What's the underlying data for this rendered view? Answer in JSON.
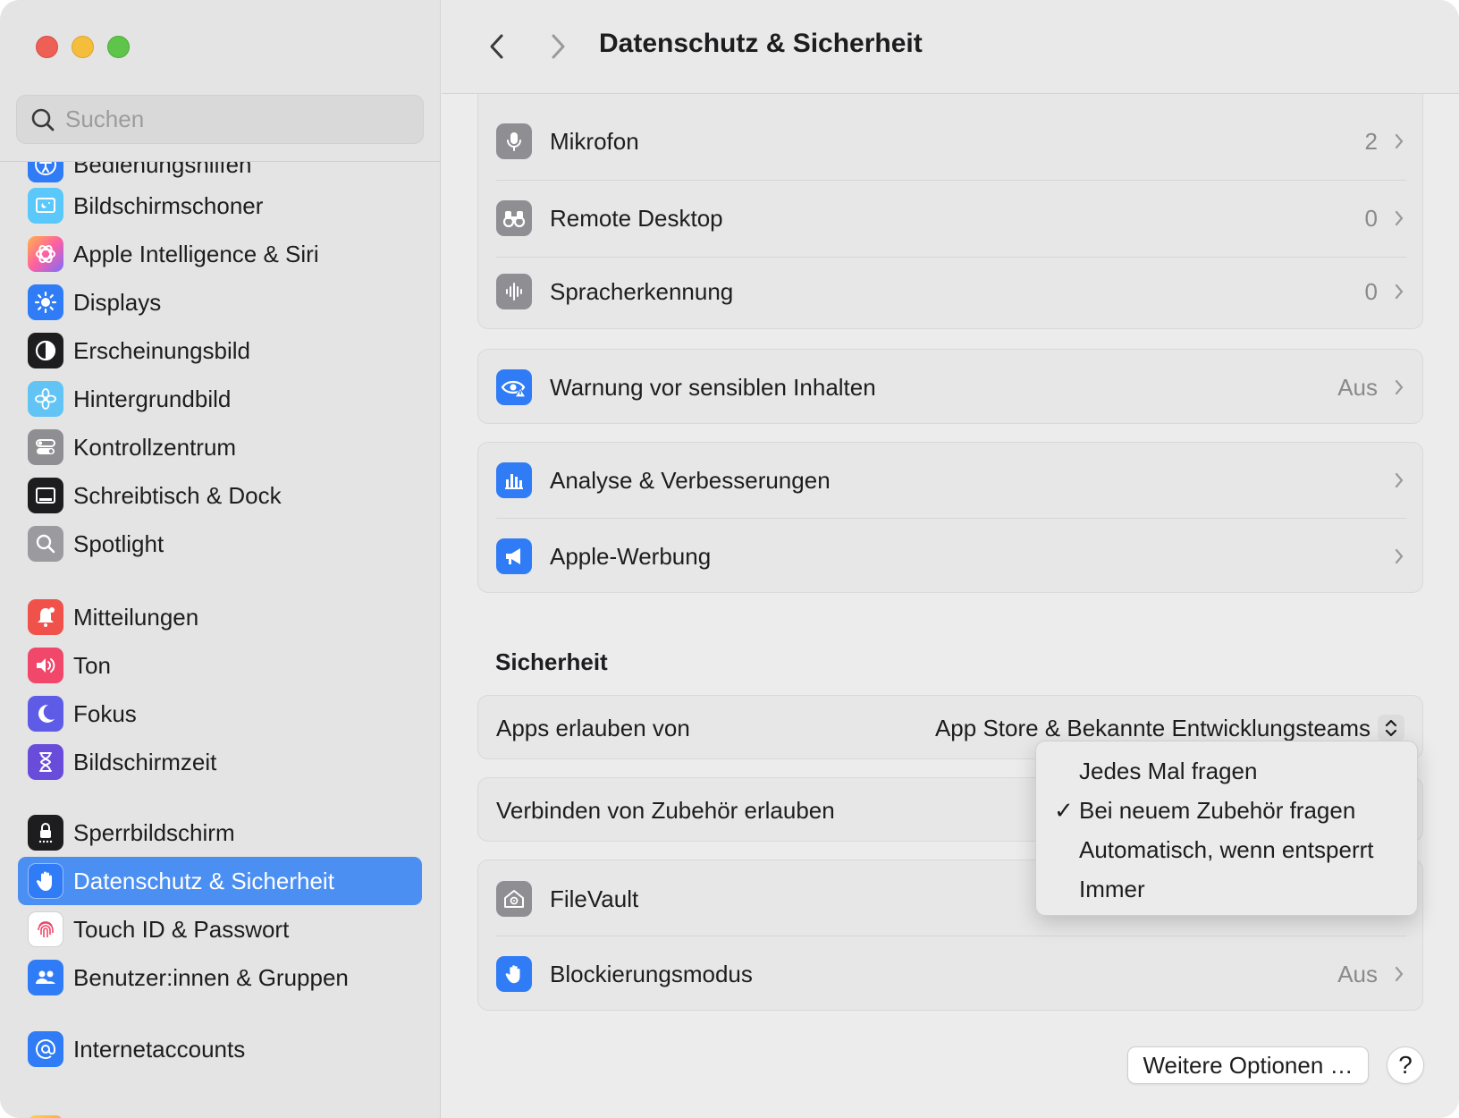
{
  "window": {
    "title": "Datenschutz & Sicherheit"
  },
  "search": {
    "placeholder": "Suchen"
  },
  "sidebar": {
    "items": [
      {
        "label": "Bedienungshilfen",
        "icon": "accessibility-icon",
        "color": "#2f7cf6"
      },
      {
        "label": "Bildschirmschoner",
        "icon": "screensaver-icon",
        "color": "#5ac8fa"
      },
      {
        "label": "Apple Intelligence & Siri",
        "icon": "siri-icon",
        "color": "#ff6fa8"
      },
      {
        "label": "Displays",
        "icon": "sun-icon",
        "color": "#2f7cf6"
      },
      {
        "label": "Erscheinungsbild",
        "icon": "appearance-icon",
        "color": "#1d1d1f"
      },
      {
        "label": "Hintergrundbild",
        "icon": "flower-icon",
        "color": "#5ac8fa"
      },
      {
        "label": "Kontrollzentrum",
        "icon": "toggles-icon",
        "color": "#8e8e93"
      },
      {
        "label": "Schreibtisch & Dock",
        "icon": "dock-icon",
        "color": "#1d1d1f"
      },
      {
        "label": "Spotlight",
        "icon": "magnifier-icon",
        "color": "#8e8e93"
      },
      {
        "label": "Mitteilungen",
        "icon": "bell-icon",
        "color": "#f0524b"
      },
      {
        "label": "Ton",
        "icon": "speaker-icon",
        "color": "#f0476a"
      },
      {
        "label": "Fokus",
        "icon": "moon-icon",
        "color": "#5e5ce6"
      },
      {
        "label": "Bildschirmzeit",
        "icon": "hourglass-icon",
        "color": "#6a4cdb"
      },
      {
        "label": "Sperrbildschirm",
        "icon": "lock-icon",
        "color": "#1d1d1f"
      },
      {
        "label": "Datenschutz & Sicherheit",
        "icon": "hand-icon",
        "color": "#2f7cf6",
        "active": true
      },
      {
        "label": "Touch ID & Passwort",
        "icon": "fingerprint-icon",
        "color": "#ffffff"
      },
      {
        "label": "Benutzer:innen & Gruppen",
        "icon": "users-icon",
        "color": "#2f7cf6"
      },
      {
        "label": "Internetaccounts",
        "icon": "at-icon",
        "color": "#2f7cf6"
      }
    ]
  },
  "privacy": {
    "rows": [
      {
        "label": "Mikrofon",
        "value": "2",
        "icon": "microphone-icon"
      },
      {
        "label": "Remote Desktop",
        "value": "0",
        "icon": "binoculars-icon"
      },
      {
        "label": "Spracherkennung",
        "value": "0",
        "icon": "waveform-icon"
      }
    ],
    "sensitive": {
      "label": "Warnung vor sensiblen Inhalten",
      "value": "Aus",
      "icon": "eye-warning-icon"
    },
    "analytics": {
      "label": "Analyse & Verbesserungen",
      "icon": "chart-icon"
    },
    "ads": {
      "label": "Apple-Werbung",
      "icon": "megaphone-icon"
    }
  },
  "security": {
    "title": "Sicherheit",
    "apps_label": "Apps erlauben von",
    "apps_value": "App Store & Bekannte Entwicklungsteams",
    "accessory_label": "Verbinden von Zubehör erlauben",
    "filevault_label": "FileVault",
    "lockdown_label": "Blockierungsmodus",
    "lockdown_value": "Aus"
  },
  "popup": {
    "options": [
      {
        "label": "Jedes Mal fragen",
        "checked": false
      },
      {
        "label": "Bei neuem Zubehör fragen",
        "checked": true
      },
      {
        "label": "Automatisch, wenn entsperrt",
        "checked": false
      },
      {
        "label": "Immer",
        "checked": false
      }
    ],
    "checkmark": "✓"
  },
  "footer": {
    "more_button": "Weitere Optionen …",
    "help_button": "?"
  }
}
